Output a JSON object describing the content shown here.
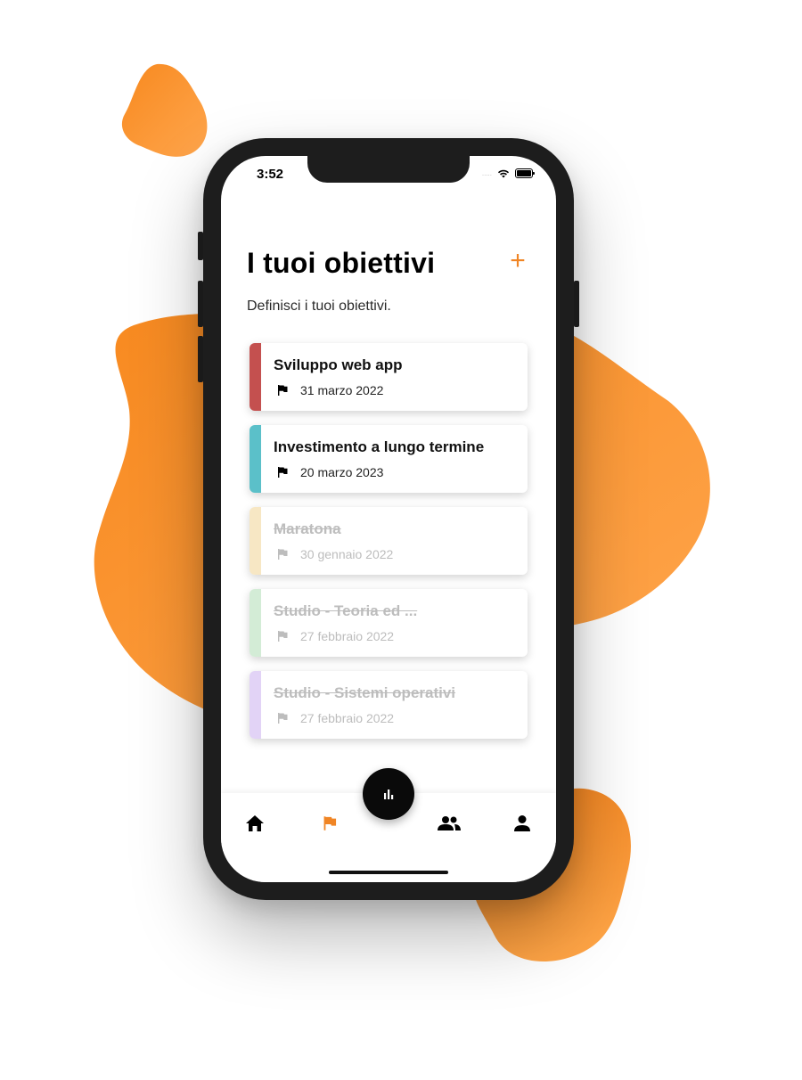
{
  "status_bar": {
    "time": "3:52",
    "signal": "....."
  },
  "header": {
    "title": "I tuoi obiettivi",
    "add_label": "+",
    "subtitle": "Definisci i tuoi obiettivi."
  },
  "goals": [
    {
      "title": "Sviluppo web app",
      "date": "31 marzo 2022",
      "color": "#c4504f",
      "completed": false
    },
    {
      "title": "Investimento a lungo termine",
      "date": "20 marzo 2023",
      "color": "#5bc0c9",
      "completed": false
    },
    {
      "title": "Maratona",
      "date": "30 gennaio 2022",
      "color": "#f7e7c4",
      "completed": true
    },
    {
      "title": "Studio - Teoria ed ...",
      "date": "27 febbraio 2022",
      "color": "#d3ecd6",
      "completed": true
    },
    {
      "title": "Studio - Sistemi operativi",
      "date": "27 febbraio 2022",
      "color": "#e2d3f6",
      "completed": true
    }
  ],
  "nav": {
    "items": [
      {
        "name": "home-icon",
        "active": false
      },
      {
        "name": "flag-icon",
        "active": true
      },
      {
        "name": "group-icon",
        "active": false
      },
      {
        "name": "person-icon",
        "active": false
      }
    ],
    "fab_icon": "bar-chart-icon"
  },
  "colors": {
    "accent": "#f08525",
    "blob": "#f7892a",
    "text": "#111111",
    "muted": "#bdbdbd"
  }
}
